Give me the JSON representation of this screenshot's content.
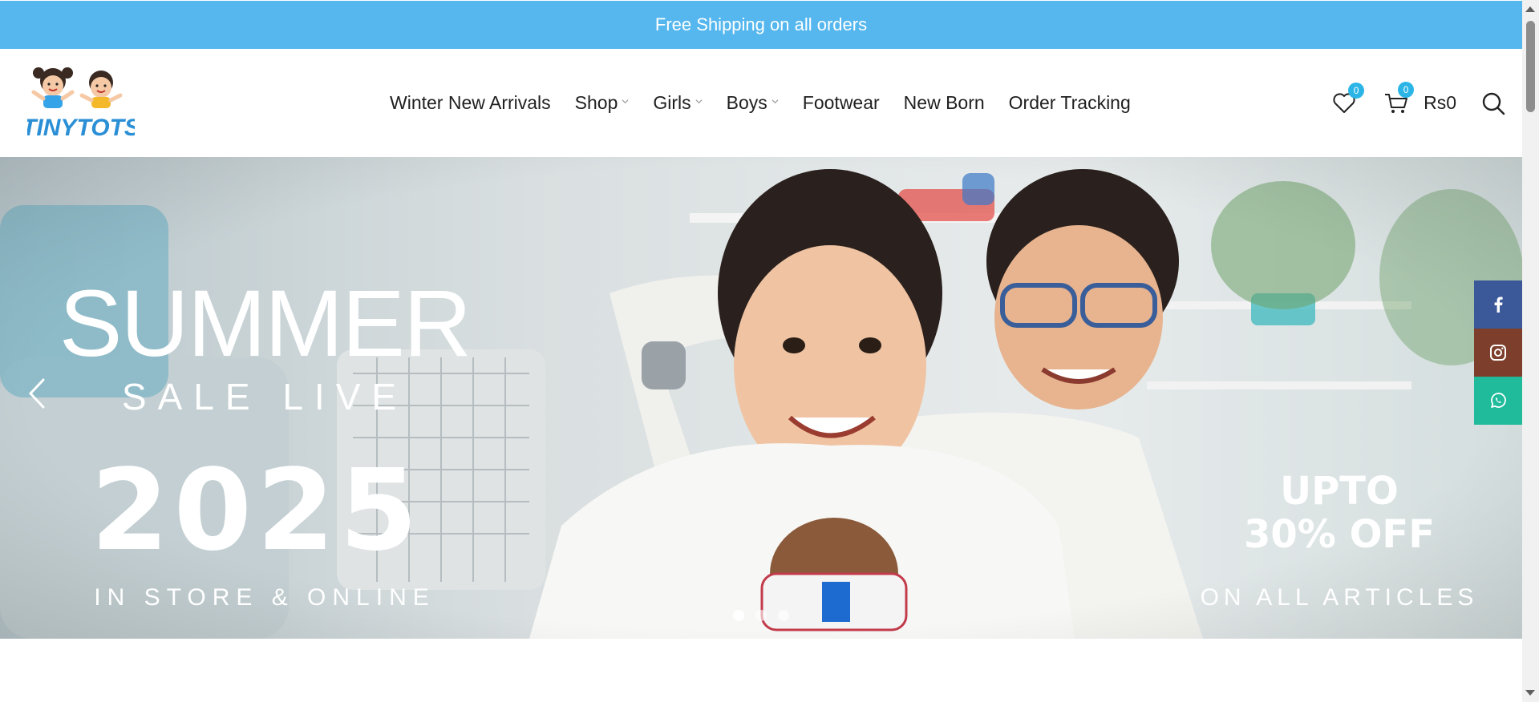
{
  "announcement": {
    "text": "Free Shipping on all orders"
  },
  "brand": {
    "logo_text": "TINYTOTS",
    "accent": "#55b7ee",
    "logo_color": "#2b8fd6"
  },
  "nav": {
    "items": [
      {
        "label": "Winter New Arrivals",
        "dropdown": false
      },
      {
        "label": "Shop",
        "dropdown": true
      },
      {
        "label": "Girls",
        "dropdown": true
      },
      {
        "label": "Boys",
        "dropdown": true
      },
      {
        "label": "Footwear",
        "dropdown": false
      },
      {
        "label": "New Born",
        "dropdown": false
      },
      {
        "label": "Order Tracking",
        "dropdown": false
      }
    ]
  },
  "header_tools": {
    "wishlist_count": "0",
    "cart_count": "0",
    "cart_total": "Rs0",
    "icons": [
      "heart-icon",
      "cart-icon",
      "search-icon"
    ]
  },
  "hero": {
    "line1": "SUMMER",
    "line2": "SALE LIVE",
    "line3": "2025",
    "line4": "IN STORE & ONLINE",
    "offer": "UPTO\n30% OFF",
    "offer_line1": "UPTO",
    "offer_line2": "30% OFF",
    "offer_sub": "ON ALL ARTICLES",
    "slide_count": 3,
    "active_slide": 1
  },
  "social": [
    {
      "name": "facebook",
      "color": "#3b5998"
    },
    {
      "name": "instagram",
      "color": "#7d3f2b"
    },
    {
      "name": "whatsapp",
      "color": "#1fbb9b"
    }
  ]
}
